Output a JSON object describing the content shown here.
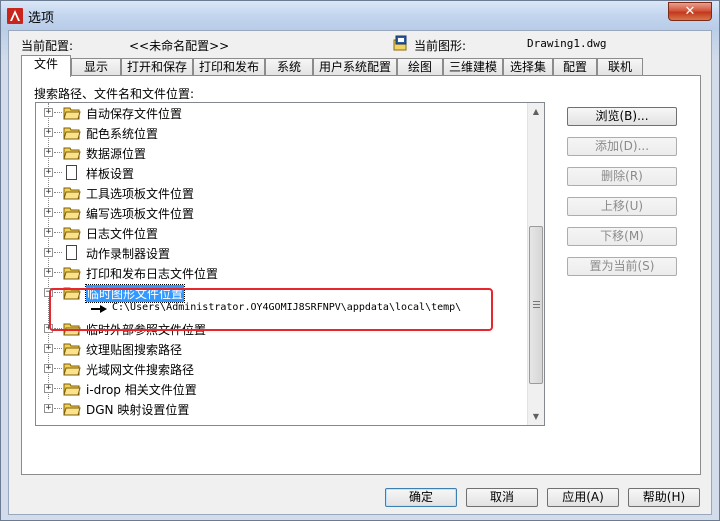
{
  "window": {
    "title": "选项",
    "close_glyph": "✕"
  },
  "header": {
    "profile_label": "当前配置:",
    "profile_value": "<<未命名配置>>",
    "drawing_label": "当前图形:",
    "drawing_value": "Drawing1.dwg"
  },
  "tabs": [
    {
      "label": "文件"
    },
    {
      "label": "显示"
    },
    {
      "label": "打开和保存"
    },
    {
      "label": "打印和发布"
    },
    {
      "label": "系统"
    },
    {
      "label": "用户系统配置"
    },
    {
      "label": "绘图"
    },
    {
      "label": "三维建模"
    },
    {
      "label": "选择集"
    },
    {
      "label": "配置"
    },
    {
      "label": "联机"
    }
  ],
  "tree": {
    "label": "搜索路径、文件名和文件位置:",
    "items": [
      {
        "label": "自动保存文件位置",
        "icon": "folder-icon",
        "expander": "+"
      },
      {
        "label": "配色系统位置",
        "icon": "folder-icon",
        "expander": "+"
      },
      {
        "label": "数据源位置",
        "icon": "folder-icon",
        "expander": "+"
      },
      {
        "label": "样板设置",
        "icon": "document-icon",
        "expander": "+"
      },
      {
        "label": "工具选项板文件位置",
        "icon": "folder-icon",
        "expander": "+"
      },
      {
        "label": "编写选项板文件位置",
        "icon": "folder-icon",
        "expander": "+"
      },
      {
        "label": "日志文件位置",
        "icon": "folder-icon",
        "expander": "+"
      },
      {
        "label": "动作录制器设置",
        "icon": "document-icon",
        "expander": "+"
      },
      {
        "label": "打印和发布日志文件位置",
        "icon": "folder-icon",
        "expander": "+"
      },
      {
        "label": "临时图形文件位置",
        "icon": "folder-icon",
        "expander": "−"
      },
      {
        "label": "临时外部参照文件位置",
        "icon": "folder-icon",
        "expander": "+"
      },
      {
        "label": "纹理贴图搜索路径",
        "icon": "folder-icon",
        "expander": "+"
      },
      {
        "label": "光域网文件搜索路径",
        "icon": "folder-icon",
        "expander": "+"
      },
      {
        "label": "i-drop 相关文件位置",
        "icon": "folder-icon",
        "expander": "+"
      },
      {
        "label": "DGN 映射设置位置",
        "icon": "folder-icon",
        "expander": "+"
      }
    ],
    "expanded_path": "C:\\Users\\Administrator.OY4GOMIJ8SRFNPV\\appdata\\local\\temp\\"
  },
  "side_buttons": {
    "browse": "浏览(B)...",
    "add": "添加(D)...",
    "remove": "删除(R)",
    "move_up": "上移(U)",
    "move_down": "下移(M)",
    "set_current": "置为当前(S)"
  },
  "footer_buttons": {
    "ok": "确定",
    "cancel": "取消",
    "apply": "应用(A)",
    "help": "帮助(H)"
  },
  "colors": {
    "selection": "#3399ff",
    "annotation_box": "#e8262d",
    "close_button": "#c2391c"
  }
}
